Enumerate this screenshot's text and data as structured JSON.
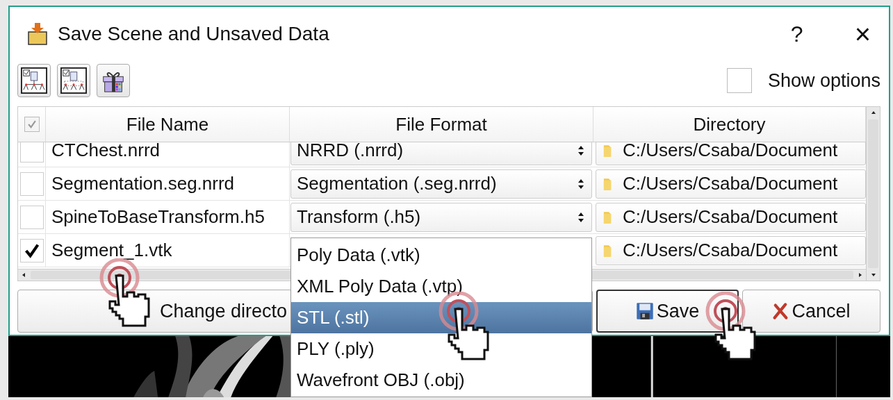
{
  "window": {
    "title": "Save Scene and Unsaved Data",
    "help": "?",
    "close": "×"
  },
  "toolbar": {
    "show_options": {
      "label": "Show options",
      "checked": false
    }
  },
  "table": {
    "header_checkbox": {
      "checked": true,
      "disabled": true
    },
    "columns": [
      "File Name",
      "File Format",
      "Directory"
    ],
    "rows": [
      {
        "checked": false,
        "file_name": "CTChest.nrrd",
        "file_format": "NRRD (.nrrd)",
        "directory": "C:/Users/Csaba/Document"
      },
      {
        "checked": false,
        "file_name": "Segmentation.seg.nrrd",
        "file_format": "Segmentation (.seg.nrrd)",
        "directory": "C:/Users/Csaba/Document"
      },
      {
        "checked": false,
        "file_name": "SpineToBaseTransform.h5",
        "file_format": "Transform (.h5)",
        "directory": "C:/Users/Csaba/Document"
      },
      {
        "checked": true,
        "file_name": "Segment_1.vtk",
        "directory": "C:/Users/Csaba/Document"
      }
    ]
  },
  "format_dropdown": [
    {
      "label": "Poly Data (.vtk)",
      "selected": false
    },
    {
      "label": "XML Poly Data (.vtp)",
      "selected": false
    },
    {
      "label": "STL (.stl)",
      "selected": true
    },
    {
      "label": "PLY (.ply)",
      "selected": false
    },
    {
      "label": "Wavefront OBJ (.obj)",
      "selected": false
    }
  ],
  "buttons": {
    "change_directory": "Change directo",
    "save": "Save",
    "cancel": "Cancel"
  }
}
